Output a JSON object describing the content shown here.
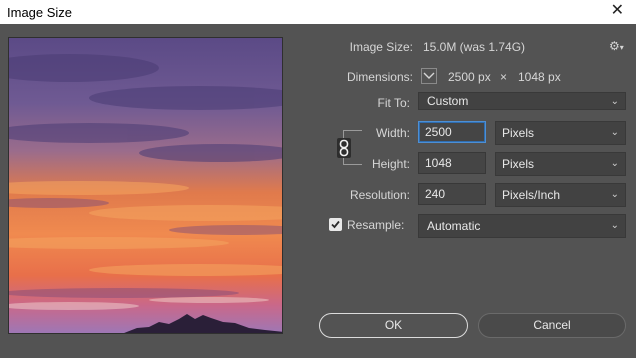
{
  "window": {
    "title": "Image Size",
    "close_glyph": "✕"
  },
  "preview": {
    "icon": "sunset-sky-preview"
  },
  "image_size": {
    "label": "Image Size:",
    "value": "15.0M (was 1.74G)"
  },
  "dimensions": {
    "label": "Dimensions:",
    "width": "2500 px",
    "times": "×",
    "height": "1048 px"
  },
  "fit_to": {
    "label": "Fit To:",
    "selected": "Custom"
  },
  "width": {
    "label": "Width:",
    "value": "2500",
    "unit": "Pixels"
  },
  "height": {
    "label": "Height:",
    "value": "1048",
    "unit": "Pixels"
  },
  "resolution": {
    "label": "Resolution:",
    "value": "240",
    "unit": "Pixels/Inch"
  },
  "resample": {
    "label": "Resample:",
    "checked": true,
    "selected": "Automatic"
  },
  "buttons": {
    "ok": "OK",
    "cancel": "Cancel"
  },
  "glyphs": {
    "chevron": "⌄",
    "gear": "⚙"
  },
  "colors": {
    "panel": "#535353",
    "field": "#454545",
    "focus": "#4d8fd4",
    "titlebar": "#ffffff"
  }
}
